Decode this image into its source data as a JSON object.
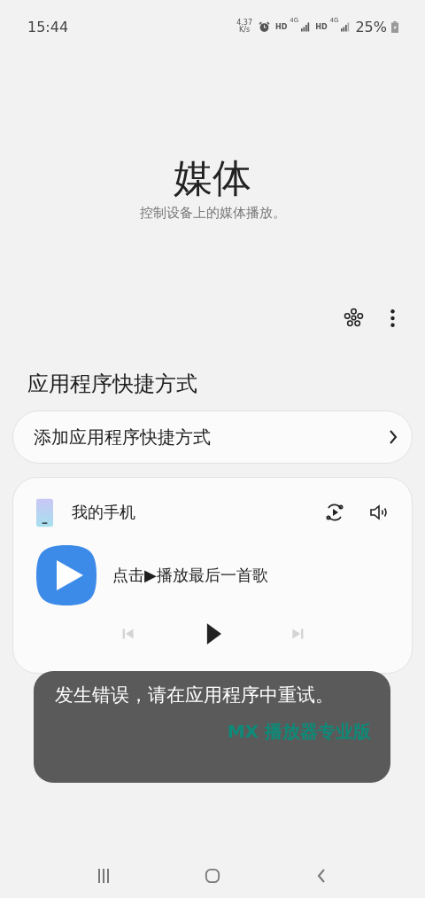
{
  "status_bar": {
    "time": "15:44",
    "net_speed": "4.37",
    "net_unit": "K/s",
    "sim1_hd": "HD",
    "sim1_net": "4G",
    "sim2_hd": "HD",
    "sim2_net": "4G",
    "battery": "25%"
  },
  "header": {
    "title": "媒体",
    "subtitle": "控制设备上的媒体播放。"
  },
  "section_title": "应用程序快捷方式",
  "add_shortcut": {
    "label": "添加应用程序快捷方式"
  },
  "media_card": {
    "device": "我的手机",
    "track": "点击▶播放最后一首歌",
    "controls": [
      {
        "kind": "prev",
        "disabled": true
      },
      {
        "kind": "play",
        "disabled": false
      },
      {
        "kind": "next",
        "disabled": true
      }
    ]
  },
  "toast": {
    "message": "发生错误，请在应用程序中重试。",
    "app": "MX 播放器专业版"
  }
}
